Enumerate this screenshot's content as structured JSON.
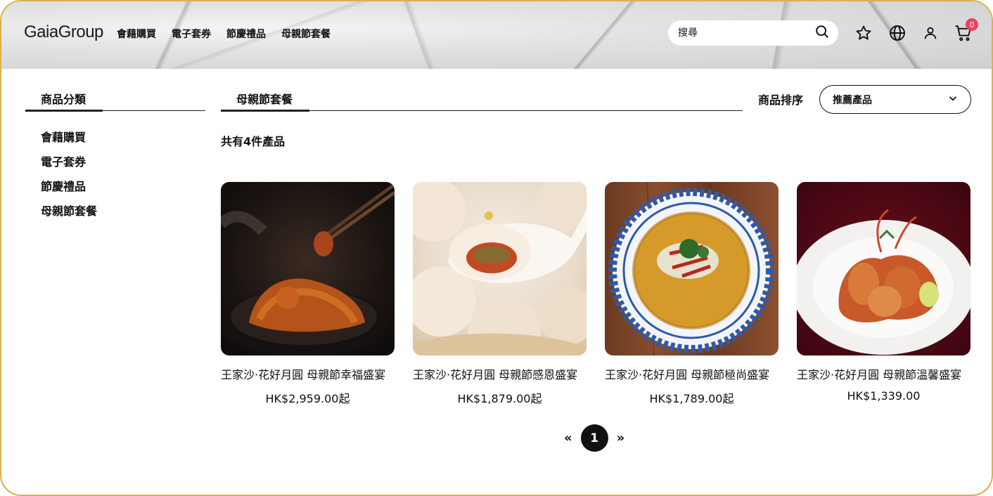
{
  "header": {
    "logo": "GaiaGroup",
    "nav": [
      "會藉購買",
      "電子套券",
      "節慶禮品",
      "母親節套餐"
    ],
    "search_placeholder": "搜尋",
    "cart_count": "0"
  },
  "sidebar": {
    "title": "商品分類",
    "items": [
      "會藉購買",
      "電子套券",
      "節慶禮品",
      "母親節套餐"
    ]
  },
  "main": {
    "title": "母親節套餐",
    "count_text": "共有4件產品",
    "sort_label": "商品排序",
    "sort_value": "推薦產品"
  },
  "products": [
    {
      "name": "王家沙·花好月圓 母親節幸福盛宴",
      "price": "HK$2,959.00起"
    },
    {
      "name": "王家沙·花好月圓 母親節感恩盛宴",
      "price": "HK$1,879.00起"
    },
    {
      "name": "王家沙·花好月圓 母親節極尚盛宴",
      "price": "HK$1,789.00起"
    },
    {
      "name": "王家沙·花好月圓 母親節溫馨盛宴",
      "price": "HK$1,339.00"
    }
  ],
  "pagination": {
    "prev": "«",
    "current": "1",
    "next": "»"
  }
}
